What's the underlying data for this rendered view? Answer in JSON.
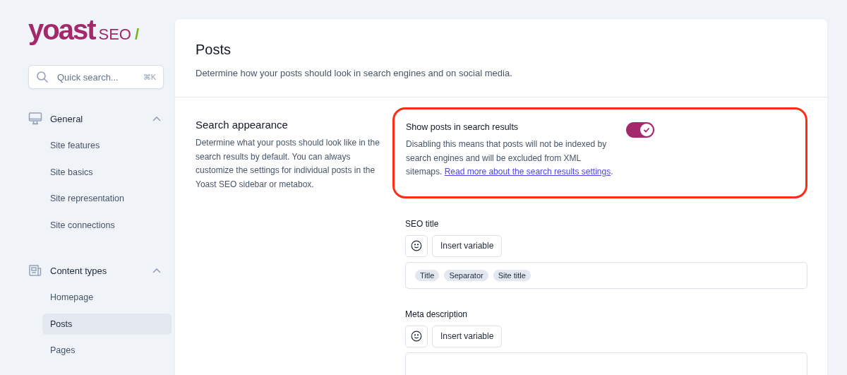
{
  "logo": {
    "wordmark": "yoast",
    "product": "SEO",
    "slash": "/"
  },
  "search": {
    "placeholder": "Quick search...",
    "shortcut": "⌘K"
  },
  "sidebar": {
    "sections": [
      {
        "label": "General",
        "expanded": true,
        "items": [
          {
            "label": "Site features",
            "selected": false
          },
          {
            "label": "Site basics",
            "selected": false
          },
          {
            "label": "Site representation",
            "selected": false
          },
          {
            "label": "Site connections",
            "selected": false
          }
        ]
      },
      {
        "label": "Content types",
        "expanded": true,
        "items": [
          {
            "label": "Homepage",
            "selected": false
          },
          {
            "label": "Posts",
            "selected": true
          },
          {
            "label": "Pages",
            "selected": false
          }
        ]
      }
    ]
  },
  "page": {
    "title": "Posts",
    "subtitle": "Determine how your posts should look in search engines and on social media."
  },
  "section": {
    "title": "Search appearance",
    "description": "Determine what your posts should look like in the search results by default. You can always customize the settings for individual posts in the Yoast SEO sidebar or metabox.",
    "toggle": {
      "label": "Show posts in search results",
      "on": true,
      "highlighted": true,
      "description": "Disabling this means that posts will not be indexed by search engines and will be excluded from XML sitemaps.",
      "link": "Read more about the search results settings",
      "after_link": "."
    },
    "fields": [
      {
        "label": "SEO title",
        "button": "Insert variable",
        "chips": [
          "Title",
          "Separator",
          "Site title"
        ]
      },
      {
        "label": "Meta description",
        "button": "Insert variable"
      }
    ]
  }
}
